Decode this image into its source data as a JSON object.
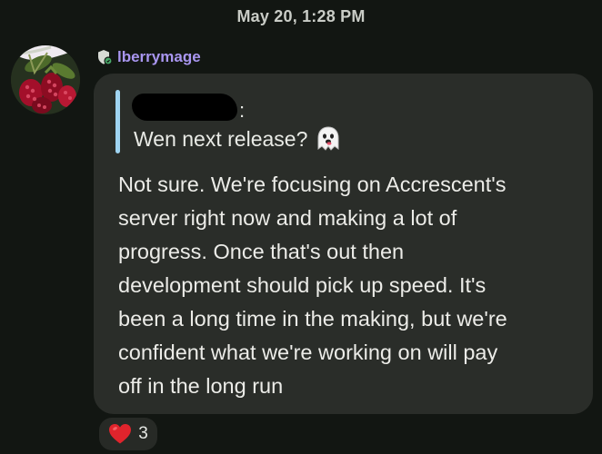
{
  "timestamp": "May 20, 1:28 PM",
  "message": {
    "sender": {
      "name": "lberrymage",
      "avatar_icon": "raspberry-avatar",
      "badge_icon": "shield-icon"
    },
    "quote": {
      "author_suffix": ":",
      "author_redacted": true,
      "text": "Wen next release?",
      "emoji_icon": "ghost-icon"
    },
    "body_lines": [
      "Not sure. We're focusing on Accrescent's",
      "server right now and making a lot of",
      "progress. Once that's out then",
      "development should pick up speed. It's",
      "been a long time in the making, but we're",
      "confident what we're working on will pay",
      "off in the long run"
    ],
    "reaction": {
      "icon": "heart-icon",
      "count": "3"
    }
  },
  "colors": {
    "background": "#121612",
    "bubble": "#2a2d29",
    "sender_name": "#a996f0",
    "quote_bar": "#9fd4f1",
    "heart": "#e0242c"
  }
}
